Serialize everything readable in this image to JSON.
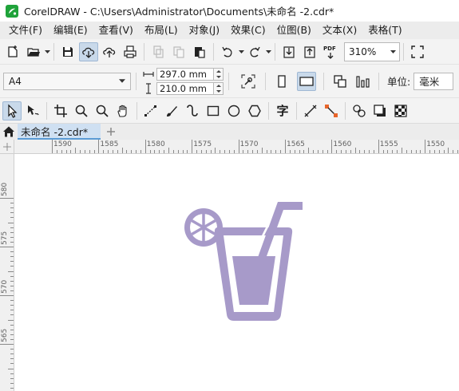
{
  "window": {
    "title": "CorelDRAW - C:\\Users\\Administrator\\Documents\\未命名 -2.cdr*",
    "logo_icon": "coreldraw-logo-icon"
  },
  "menu": {
    "items": [
      "文件(F)",
      "编辑(E)",
      "查看(V)",
      "布局(L)",
      "对象(J)",
      "效果(C)",
      "位图(B)",
      "文本(X)",
      "表格(T)"
    ]
  },
  "standard_toolbar": {
    "icons": [
      "new-document-icon",
      "open-folder-icon",
      "save-icon",
      "cloud-download-icon",
      "cloud-upload-icon",
      "print-icon",
      "cut-icon",
      "copy-icon",
      "paste-icon",
      "undo-icon",
      "redo-icon",
      "import-icon",
      "export-icon",
      "publish-pdf-icon"
    ],
    "pdf_label": "PDF",
    "zoom": "310%"
  },
  "property_bar": {
    "paper_size": "A4",
    "width": "297.0 mm",
    "height": "210.0 mm",
    "unit_label": "单位:",
    "unit_value": "毫米"
  },
  "tools": {
    "icons": [
      "pick-tool-icon",
      "shape-tool-icon",
      "crop-tool-icon",
      "zoom-tool-icon",
      "zoom-out-icon",
      "pan-tool-icon",
      "freehand-tool-icon",
      "artistic-media-icon",
      "smart-drawing-icon",
      "rectangle-tool-icon",
      "ellipse-tool-icon",
      "polygon-tool-icon",
      "text-tool-icon",
      "dimension-tool-icon",
      "connector-tool-icon",
      "blend-tool-icon",
      "drop-shadow-icon",
      "transparency-tool-icon"
    ],
    "text_tool_glyph": "字"
  },
  "tabs": {
    "doc_name": "未命名 -2.cdr*"
  },
  "rulers": {
    "horizontal": [
      "1590",
      "1585",
      "1580",
      "1575",
      "1570",
      "1565",
      "1560",
      "1555",
      "1550"
    ],
    "vertical": [
      "580",
      "575",
      "570",
      "565"
    ]
  },
  "canvas": {
    "graphic": "drink-cup-with-straw-and-lemon-icon",
    "graphic_color": "#a79ac9"
  }
}
